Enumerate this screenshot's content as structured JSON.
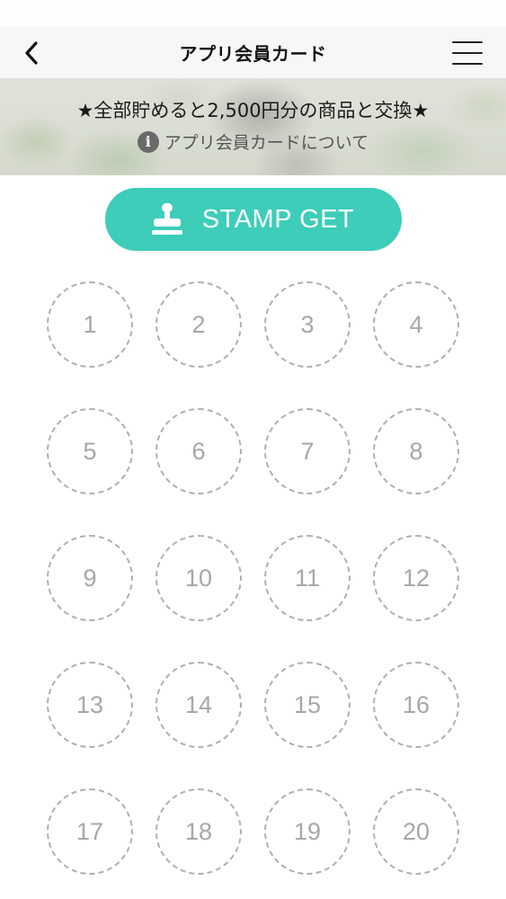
{
  "navbar": {
    "back_icon": "chevron-left-icon",
    "title": "アプリ会員カード",
    "menu_icon": "hamburger-menu-icon"
  },
  "banner": {
    "headline": "★全部貯めると2,500円分の商品と交換★",
    "info_icon": "info-circle-icon",
    "info_link": "アプリ会員カードについて"
  },
  "stamp_button": {
    "label": "STAMP GET",
    "icon": "stamp-icon",
    "color": "#3dcdb9"
  },
  "stamps": {
    "total": 20,
    "collected": 0,
    "slots": [
      "1",
      "2",
      "3",
      "4",
      "5",
      "6",
      "7",
      "8",
      "9",
      "10",
      "11",
      "12",
      "13",
      "14",
      "15",
      "16",
      "17",
      "18",
      "19",
      "20"
    ]
  }
}
